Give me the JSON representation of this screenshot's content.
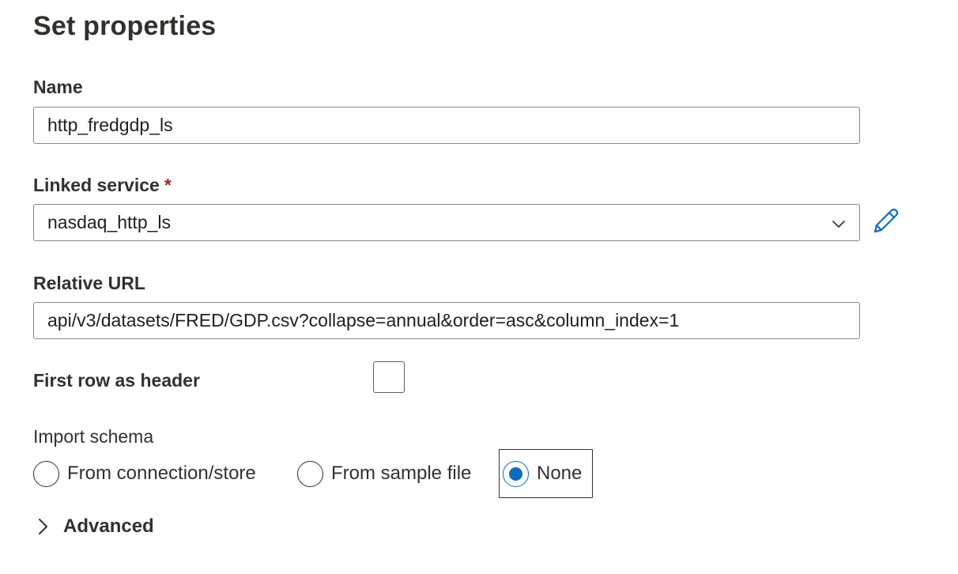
{
  "page_title": "Set properties",
  "name": {
    "label": "Name",
    "value": "http_fredgdp_ls"
  },
  "linked_service": {
    "label": "Linked service",
    "required_mark": "*",
    "selected": "nasdaq_http_ls"
  },
  "relative_url": {
    "label": "Relative URL",
    "value": "api/v3/datasets/FRED/GDP.csv?collapse=annual&order=asc&column_index=1"
  },
  "first_row_as_header": {
    "label": "First row as header",
    "checked": false
  },
  "import_schema": {
    "label": "Import schema",
    "options": [
      {
        "label": "From connection/store",
        "selected": false
      },
      {
        "label": "From sample file",
        "selected": false
      },
      {
        "label": "None",
        "selected": true
      }
    ]
  },
  "advanced": {
    "label": "Advanced",
    "expanded": false
  },
  "colors": {
    "accent": "#0f6cbd",
    "required": "#a4262c",
    "border": "#8a8886",
    "text": "#323130"
  },
  "icons": {
    "edit": "pencil-icon",
    "dropdown": "chevron-down-icon",
    "expand": "chevron-right-icon"
  }
}
